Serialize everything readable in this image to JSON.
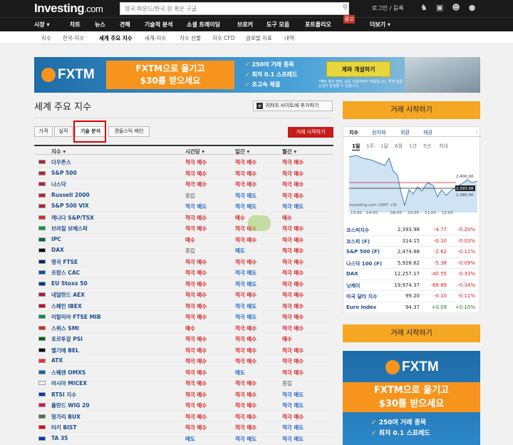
{
  "header": {
    "logo": "Investing",
    "logo_suffix": ".com",
    "search_placeholder": "영국 파운드/한국 원 혹은 구글",
    "login": "로그인 / 등록"
  },
  "nav": {
    "items": [
      "시장 ▾",
      "차트",
      "뉴스",
      "견해",
      "기술적 분석",
      "소셜 트레이딩",
      "브로커",
      "도구 모음",
      "포트폴리오",
      "더보기 ▾"
    ],
    "ad_badge": "광고"
  },
  "subnav": {
    "items": [
      "지수",
      "한국-지수",
      "세계 주요 지수",
      "세계-지수",
      "지수 선물",
      "지수 CFD",
      "글로벌 지표",
      "내역"
    ]
  },
  "banner": {
    "brand": "FXTM",
    "headline_1": "FXTM으로 옮기고",
    "headline_2": "$30를 받으세요",
    "features": [
      "250여 거래 종목",
      "최저 0.1 스프레드",
      "초고속 체결"
    ],
    "cta": "계좌 개설하기",
    "disclaimer": "*해당 행사 관련, 모든 이용약관이 적용됩니다. 투자 원금 손실이 발생할 수 있습니다."
  },
  "page": {
    "title": "세계 주요 지수",
    "add_site": "귀하의 사이트에 추가하기",
    "tabs": [
      "가격",
      "실적",
      "기술 분석",
      "캔들스틱 패턴"
    ],
    "start_trading_small": "거래 시작하기"
  },
  "table": {
    "headers": [
      "지수 ▾",
      "시간당 ▾",
      "일간 ▾",
      "월간 ▾"
    ],
    "rows": [
      {
        "name": "다우존스",
        "h": "적극 매수",
        "d": "적극 매수",
        "m": "적극 매수"
      },
      {
        "name": "S&P 500",
        "h": "적극 매수",
        "d": "적극 매수",
        "m": "적극 매수"
      },
      {
        "name": "나스닥",
        "h": "적극 매수",
        "d": "적극 매수",
        "m": "적극 매수"
      },
      {
        "name": "Russell 2000",
        "h": "중립",
        "d": "적극 매도",
        "m": "적극 매수"
      },
      {
        "name": "S&P 500 VIX",
        "h": "적극 매도",
        "d": "적극 매도",
        "m": "적극 매도"
      },
      {
        "name": "캐나다 S&P/TSX",
        "h": "적극 매수",
        "d": "매수",
        "m": "매수"
      },
      {
        "name": "브라질 보베스파",
        "h": "적극 매수",
        "d": "적극 매수",
        "m": "적극 매수"
      },
      {
        "name": "IPC",
        "h": "매수",
        "d": "적극 매수",
        "m": "적극 매수"
      },
      {
        "name": "DAX",
        "h": "중립",
        "d": "매도",
        "m": "적극 매수"
      },
      {
        "name": "영국 FTSE",
        "h": "적극 매수",
        "d": "적극 매수",
        "m": "적극 매수"
      },
      {
        "name": "프랑스 CAC",
        "h": "적극 매수",
        "d": "적극 매도",
        "m": "적극 매수"
      },
      {
        "name": "EU Stoxx 50",
        "h": "적극 매수",
        "d": "적극 매도",
        "m": "적극 매수"
      },
      {
        "name": "네덜란드 AEX",
        "h": "적극 매수",
        "d": "적극 매수",
        "m": "적극 매수"
      },
      {
        "name": "스페인 IBEX",
        "h": "적극 매수",
        "d": "적극 매도",
        "m": "적극 매수"
      },
      {
        "name": "이탈리아 FTSE MIB",
        "h": "적극 매수",
        "d": "적극 매도",
        "m": "적극 매수"
      },
      {
        "name": "스위스 SMI",
        "h": "매수",
        "d": "적극 매수",
        "m": "적극 매수"
      },
      {
        "name": "포르투갈 PSI",
        "h": "적극 매수",
        "d": "적극 매수",
        "m": "매수"
      },
      {
        "name": "벨기에 BEL",
        "h": "적극 매수",
        "d": "적극 매수",
        "m": "적극 매수"
      },
      {
        "name": "ATX",
        "h": "적극 매수",
        "d": "적극 매수",
        "m": "적극 매수"
      },
      {
        "name": "스웨덴 OMXS",
        "h": "적극 매수",
        "d": "매도",
        "m": "적극 매수"
      },
      {
        "name": "러시아 MICEX",
        "h": "적극 매수",
        "d": "적극 매수",
        "m": "중립"
      },
      {
        "name": "RTSI 지수",
        "h": "적극 매수",
        "d": "적극 매수",
        "m": "적극 매도"
      },
      {
        "name": "폴란드 WIG 20",
        "h": "적극 매수",
        "d": "적극 매수",
        "m": "적극 매도"
      },
      {
        "name": "헝가리 BUX",
        "h": "적극 매수",
        "d": "적극 매수",
        "m": "적극 매수"
      },
      {
        "name": "터키 BIST",
        "h": "적극 매수",
        "d": "적극 매수",
        "m": "적극 매도"
      },
      {
        "name": "TA 35",
        "h": "매도",
        "d": "적극 매도",
        "m": "적극 매도"
      }
    ]
  },
  "sidebar": {
    "start_trading": "거래 시작하기",
    "widget_tabs": [
      "지수",
      "원자재",
      "외환",
      "채권"
    ],
    "ranges": [
      "1일",
      "1주",
      "1달",
      "6월",
      "1년",
      "5년",
      "최대"
    ],
    "credit": "Investing.com (GMT +9)",
    "times": [
      "13:00",
      "14:00",
      "08:00",
      "10:00",
      "11:00",
      "12:00"
    ],
    "price_labels": [
      "2,400.00",
      "2,393.98",
      "2,380.00"
    ],
    "quotes": [
      {
        "name": "코스피지수",
        "value": "2,393.98",
        "change": "-4.77",
        "pct": "-0.20%"
      },
      {
        "name": "코스피 (F)",
        "value": "314.15",
        "change": "-0.10",
        "pct": "-0.03%"
      },
      {
        "name": "S&P 500 (F)",
        "value": "2,474.88",
        "change": "-2.62",
        "pct": "-0.11%"
      },
      {
        "name": "나스닥 100 (F)",
        "value": "5,928.62",
        "change": "-5.38",
        "pct": "-0.09%"
      },
      {
        "name": "DAX",
        "value": "12,257.17",
        "change": "-40.55",
        "pct": "-0.33%"
      },
      {
        "name": "닛케이",
        "value": "19,974.37",
        "change": "-68.89",
        "pct": "-0.34%"
      },
      {
        "name": "미국 달러 지수",
        "value": "99.20",
        "change": "-0.10",
        "pct": "-0.11%"
      },
      {
        "name": "Euro Index",
        "value": "94.37",
        "change": "+0.09",
        "pct": "+0.10%"
      }
    ],
    "start_trading_2": "거래 시작하기"
  },
  "ad2": {
    "brand": "FXTM",
    "headline_1": "FXTM으로 옮기고",
    "headline_2": "$30를 받으세요",
    "features": [
      "250여 거래 종목",
      "최저 0.1 스프레드"
    ]
  },
  "colors": {
    "buy": "#d81b1b",
    "sell": "#1e63c7",
    "accent": "#f5a623",
    "topbar": "#1a1a1a"
  }
}
